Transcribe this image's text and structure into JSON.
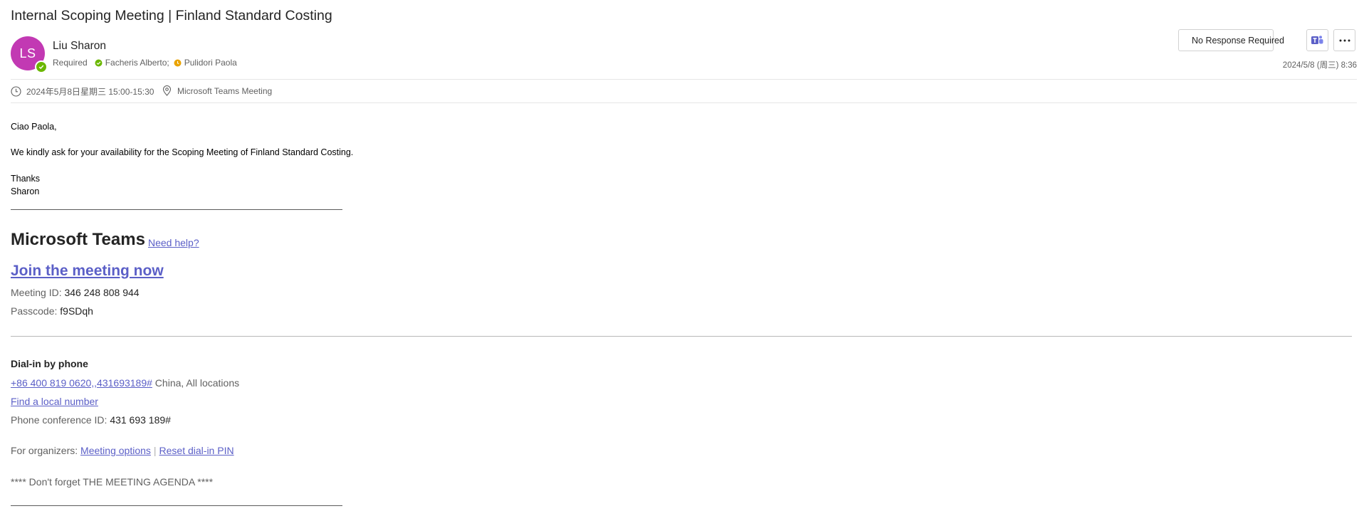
{
  "subject": "Internal Scoping Meeting | Finland Standard Costing",
  "sender": {
    "initials": "LS",
    "name": "Liu Sharon",
    "avatar_color": "#c239b3",
    "presence": "available"
  },
  "recipients": {
    "label": "Required",
    "people": [
      {
        "name": "Facheris Alberto;",
        "status_color": "#6bb700",
        "status": "accepted"
      },
      {
        "name": "Pulidori Paola",
        "status_color": "#eaa300",
        "status": "tentative"
      }
    ]
  },
  "actions": {
    "no_response_label": "No Response Required",
    "teams_icon": "teams-icon",
    "more_icon": "more-icon"
  },
  "received": "2024/5/8 (周三) 8:36",
  "meeting": {
    "when": "2024年5月8日星期三 15:00-15:30",
    "where": "Microsoft Teams Meeting"
  },
  "body": {
    "greeting": "Ciao Paola,",
    "line1": "We kindly ask for your availability for the Scoping Meeting of Finland Standard Costing.",
    "closing": "Thanks",
    "signature": "Sharon"
  },
  "teams": {
    "title": "Microsoft Teams",
    "need_help": "Need help?",
    "join": "Join the meeting now",
    "meeting_id_label": "Meeting ID: ",
    "meeting_id": "346 248 808 944",
    "passcode_label": "Passcode: ",
    "passcode": "f9SDqh",
    "dialin_heading": "Dial-in by phone",
    "phone_number": "+86 400 819 0620,,431693189#",
    "phone_location": " China, All locations",
    "find_local": "Find a local number",
    "conf_id_label": "Phone conference ID: ",
    "conf_id": "431 693 189#",
    "organizers_label": "For organizers: ",
    "meeting_options": "Meeting options",
    "pipe": "|",
    "reset_pin": "Reset dial-in PIN",
    "agenda_note": "**** Don't forget THE MEETING AGENDA ****"
  },
  "colors": {
    "link": "#5b5fc7",
    "accepted": "#6bb700",
    "tentative": "#eaa300",
    "teams_brand": "#5b5fc7"
  }
}
